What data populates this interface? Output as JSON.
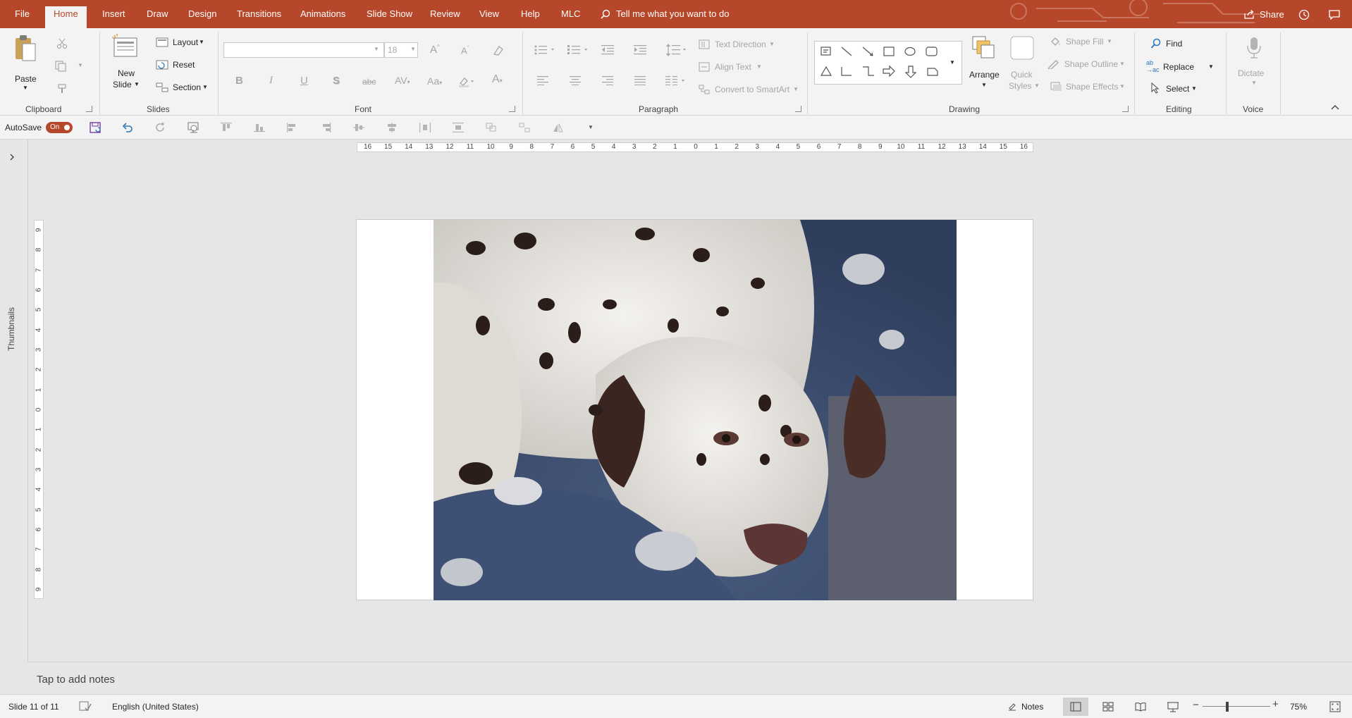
{
  "tabs": {
    "file": "File",
    "home": "Home",
    "insert": "Insert",
    "draw": "Draw",
    "design": "Design",
    "transitions": "Transitions",
    "animations": "Animations",
    "slideshow": "Slide Show",
    "review": "Review",
    "view": "View",
    "help": "Help",
    "mlc": "MLC",
    "tell_me": "Tell me what you want to do",
    "share": "Share"
  },
  "clipboard": {
    "paste": "Paste",
    "label": "Clipboard"
  },
  "slides": {
    "new_slide_1": "New",
    "new_slide_2": "Slide",
    "layout": "Layout",
    "reset": "Reset",
    "section": "Section",
    "label": "Slides"
  },
  "font": {
    "size": "18",
    "bold": "B",
    "italic": "I",
    "underline": "U",
    "shadow": "S",
    "strike": "abc",
    "label": "Font"
  },
  "paragraph": {
    "text_direction": "Text Direction",
    "align_text": "Align Text",
    "convert_smartart": "Convert to SmartArt",
    "label": "Paragraph"
  },
  "drawing": {
    "arrange": "Arrange",
    "quick_1": "Quick",
    "quick_2": "Styles",
    "shape_fill": "Shape Fill",
    "shape_outline": "Shape Outline",
    "shape_effects": "Shape Effects",
    "label": "Drawing"
  },
  "editing": {
    "find": "Find",
    "replace": "Replace",
    "select": "Select",
    "label": "Editing"
  },
  "voice": {
    "dictate": "Dictate",
    "label": "Voice"
  },
  "qat": {
    "autosave": "AutoSave",
    "toggle": "On"
  },
  "rail": {
    "thumbnails": "Thumbnails"
  },
  "ruler": {
    "h": [
      "16",
      "15",
      "14",
      "13",
      "12",
      "11",
      "10",
      "9",
      "8",
      "7",
      "6",
      "5",
      "4",
      "3",
      "2",
      "1",
      "0",
      "1",
      "2",
      "3",
      "4",
      "5",
      "6",
      "7",
      "8",
      "9",
      "10",
      "11",
      "12",
      "13",
      "14",
      "15",
      "16"
    ],
    "v": [
      "9",
      "8",
      "7",
      "6",
      "5",
      "4",
      "3",
      "2",
      "1",
      "0",
      "1",
      "2",
      "3",
      "4",
      "5",
      "6",
      "7",
      "8",
      "9"
    ]
  },
  "notes": {
    "placeholder": "Tap to add notes"
  },
  "status": {
    "slide_counter": "Slide 11 of 11",
    "language": "English (United States)",
    "notes": "Notes",
    "zoom": "75%"
  },
  "colors": {
    "accent": "#b7472a",
    "ribbon": "#f3f3f3",
    "workspace": "#e6e6e6"
  }
}
